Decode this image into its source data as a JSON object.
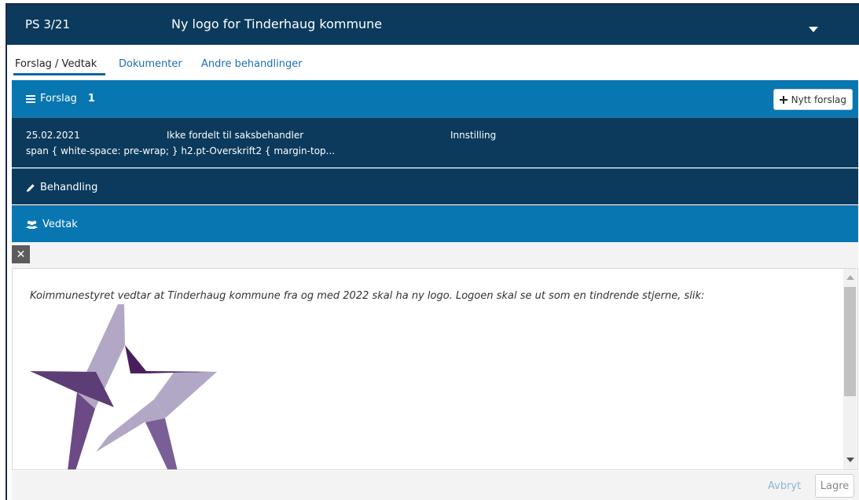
{
  "case": {
    "number": "PS 3/21",
    "title": "Ny logo for Tinderhaug kommune"
  },
  "tabs": [
    {
      "label": "Forslag / Vedtak",
      "active": true
    },
    {
      "label": "Dokumenter",
      "active": false
    },
    {
      "label": "Andre behandlinger",
      "active": false
    }
  ],
  "forslag": {
    "label": "Forslag",
    "count": "1",
    "icon": "list-icon",
    "new_button_label": "Nytt forslag"
  },
  "proposal_item": {
    "date": "25.02.2021",
    "status": "Ikke fordelt til saksbehandler",
    "type": "Innstilling",
    "snippet": "span { white-space: pre-wrap; } h2.pt-Overskrift2 { margin-top..."
  },
  "behandling": {
    "label": "Behandling",
    "icon": "pencil-icon"
  },
  "vedtak": {
    "label": "Vedtak",
    "icon": "group-icon"
  },
  "editor": {
    "text": "Koimmunestyret vedtar at Tinderhaug kommune fra og med 2022 skal ha ny logo. Logoen skal se ut som en tindrende stjerne, slik:"
  },
  "footer": {
    "cancel_label": "Avbryt",
    "save_label": "Lagre"
  },
  "colors": {
    "header_dark": "#0b3a5c",
    "header_blue": "#0876b0",
    "star_dark": "#4a1f5e",
    "star_mid": "#7a5f97",
    "star_light": "#b3a7c6"
  }
}
